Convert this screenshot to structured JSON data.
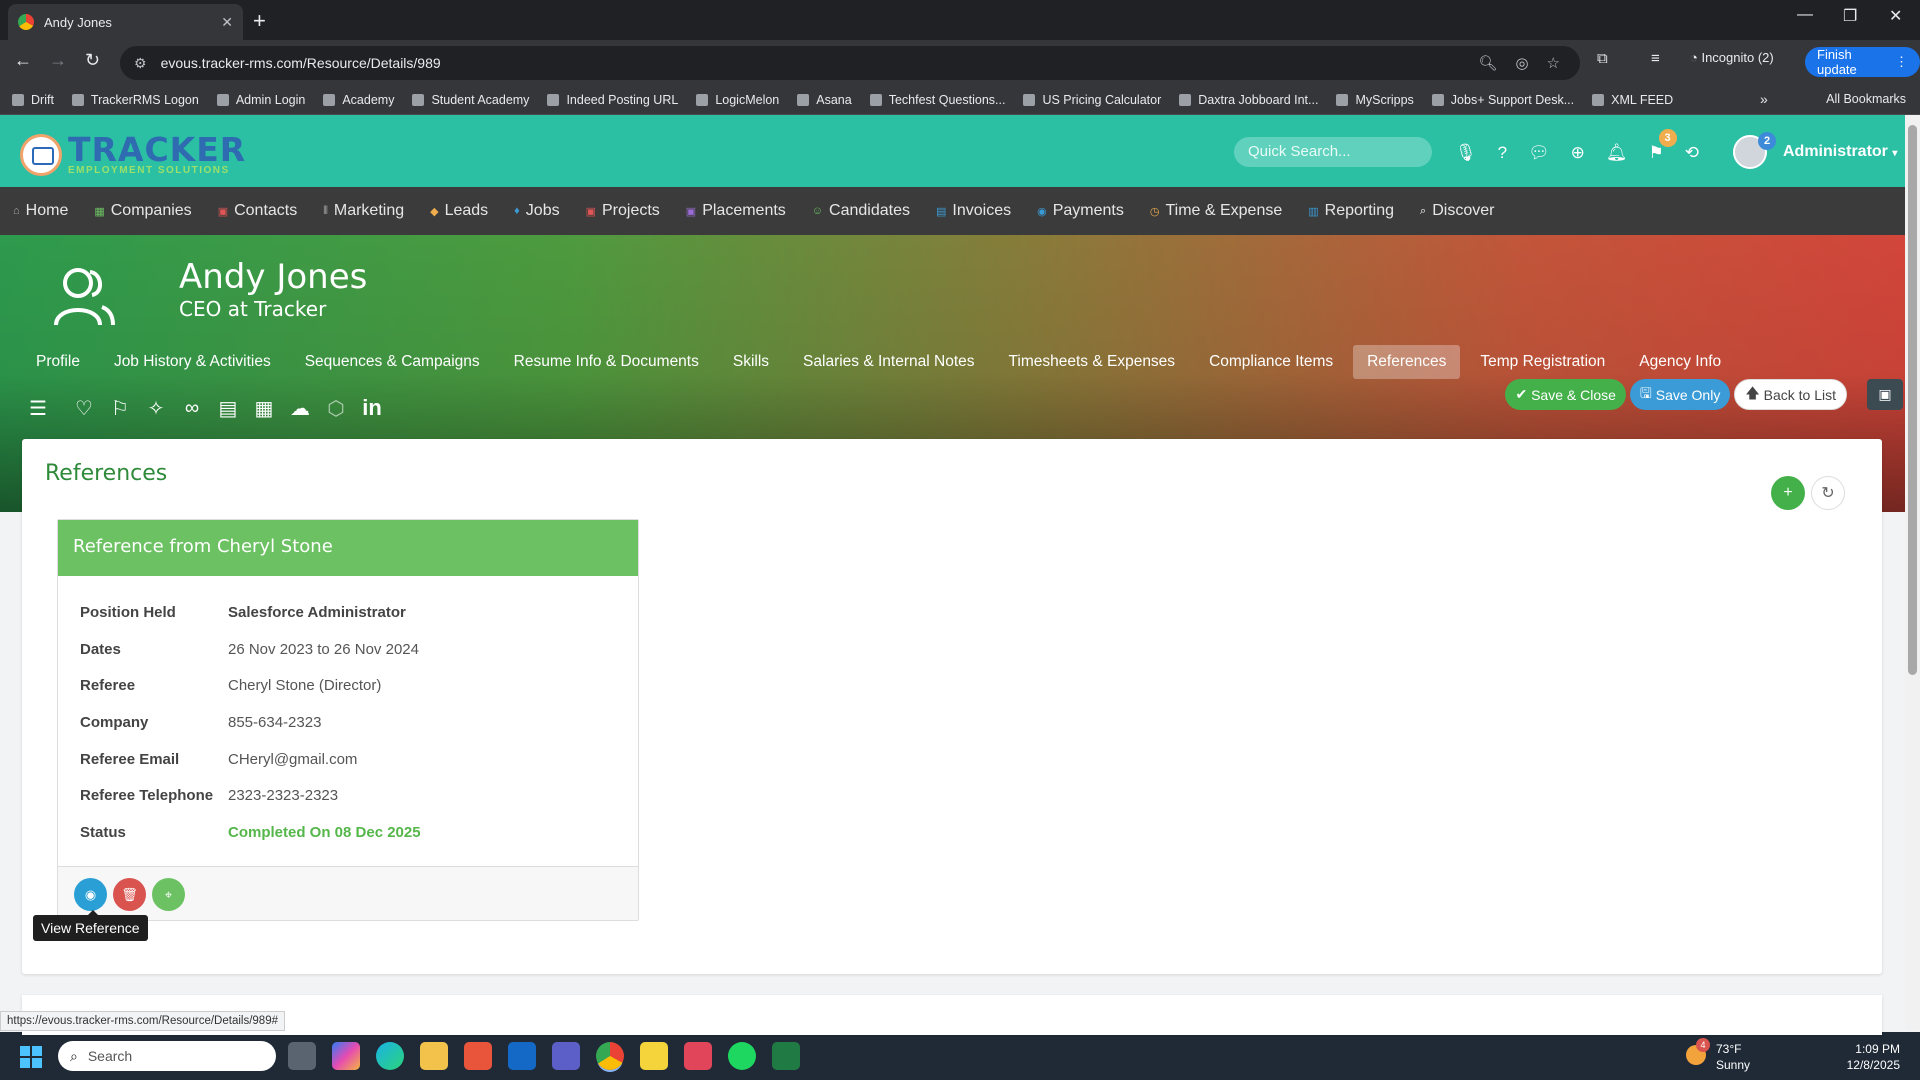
{
  "browser": {
    "tab_title": "Andy Jones",
    "url": "evous.tracker-rms.com/Resource/Details/989",
    "incognito_label": "Incognito (2)",
    "finish_update_label": "Finish update",
    "bookmarks": [
      "Drift",
      "TrackerRMS Logon",
      "Admin Login",
      "Academy",
      "Student Academy",
      "Indeed Posting URL",
      "LogicMelon",
      "Asana",
      "Techfest Questions...",
      "US Pricing Calculator",
      "Daxtra Jobboard Int...",
      "MyScripps",
      "Jobs+ Support Desk...",
      "XML FEED"
    ],
    "all_bookmarks_label": "All Bookmarks",
    "status_url": "https://evous.tracker-rms.com/Resource/Details/989#"
  },
  "header": {
    "logo_text": "TRACKER",
    "logo_subtext": "EMPLOYMENT SOLUTIONS",
    "quick_search_placeholder": "Quick Search...",
    "flag_badge": "3",
    "avatar_badge": "2",
    "user_label": "Administrator"
  },
  "nav": {
    "items": [
      "Home",
      "Companies",
      "Contacts",
      "Marketing",
      "Leads",
      "Jobs",
      "Projects",
      "Placements",
      "Candidates",
      "Invoices",
      "Payments",
      "Time & Expense",
      "Reporting",
      "Discover"
    ]
  },
  "profile": {
    "name": "Andy Jones",
    "title": "CEO at Tracker",
    "tabs": [
      "Profile",
      "Job History & Activities",
      "Sequences & Campaigns",
      "Resume Info & Documents",
      "Skills",
      "Salaries & Internal Notes",
      "Timesheets & Expenses",
      "Compliance Items",
      "References",
      "Temp Registration",
      "Agency Info"
    ],
    "active_tab": "References"
  },
  "actions": {
    "save_close": "Save & Close",
    "save_only": "Save Only",
    "back_to_list": "Back to List"
  },
  "references": {
    "section_title": "References",
    "card": {
      "title": "Reference from Cheryl Stone",
      "fields": [
        {
          "label": "Position Held",
          "value": "Salesforce Administrator"
        },
        {
          "label": "Dates",
          "value": "26 Nov 2023 to 26 Nov 2024"
        },
        {
          "label": "Referee",
          "value": "Cheryl Stone (Director)"
        },
        {
          "label": "Company",
          "value": "855-634-2323"
        },
        {
          "label": "Referee Email",
          "value": "CHeryl@gmail.com"
        },
        {
          "label": "Referee Telephone",
          "value": "2323-2323-2323"
        },
        {
          "label": "Status",
          "value": "Completed On 08 Dec 2025"
        }
      ]
    },
    "tooltip": "View Reference"
  },
  "taskbar": {
    "search_placeholder": "Search",
    "weather_temp": "73°F",
    "weather_desc": "Sunny",
    "weather_badge": "4",
    "time": "1:09 PM",
    "date": "12/8/2025"
  },
  "colors": {
    "header_teal": "#2bbfa4",
    "nav_dark": "#3b3b3b",
    "accent_green": "#6cc163",
    "title_green": "#2f8a3a",
    "status_green": "#55b64a",
    "link_blue": "#3a9bd6"
  }
}
